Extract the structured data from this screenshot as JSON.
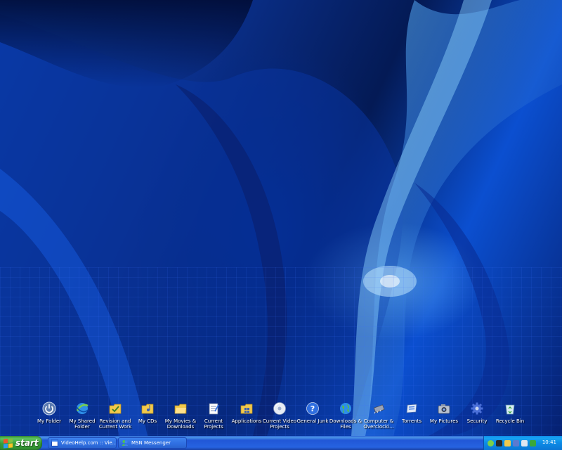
{
  "desktop": {
    "icons": [
      {
        "label": "My Folder",
        "icon": "power-icon"
      },
      {
        "label": "My Shared\nFolder",
        "icon": "globe-folder-icon"
      },
      {
        "label": "Revision and\nCurrent Work",
        "icon": "folder-check-icon"
      },
      {
        "label": "My CDs",
        "icon": "folder-music-icon"
      },
      {
        "label": "My Movies &\nDownloads",
        "icon": "folder-icon"
      },
      {
        "label": "Current\nProjects",
        "icon": "notepad-icon"
      },
      {
        "label": "Applications",
        "icon": "folder-apps-icon"
      },
      {
        "label": "Current Video\nProjects",
        "icon": "disc-icon"
      },
      {
        "label": "General Junk",
        "icon": "help-icon"
      },
      {
        "label": "Downloads &\nFiles",
        "icon": "globe-icon"
      },
      {
        "label": "Computer &\nOverclocki...",
        "icon": "chip-icon"
      },
      {
        "label": "Torrents",
        "icon": "torrent-icon"
      },
      {
        "label": "My Pictures",
        "icon": "camera-icon"
      },
      {
        "label": "Security",
        "icon": "gear-icon"
      },
      {
        "label": "Recycle Bin",
        "icon": "recycle-bin-icon"
      }
    ]
  },
  "taskbar": {
    "start_label": "start",
    "tasks": [
      {
        "label": "VideoHelp.com :: Vie...",
        "icon": "ie-window-icon"
      },
      {
        "label": "MSN Messenger",
        "icon": "msn-icon"
      }
    ],
    "clock": "10:41"
  },
  "colors": {
    "start_green": "#3c9a3c",
    "taskbar_blue": "#2663e0",
    "tray_blue": "#0c8be6"
  }
}
